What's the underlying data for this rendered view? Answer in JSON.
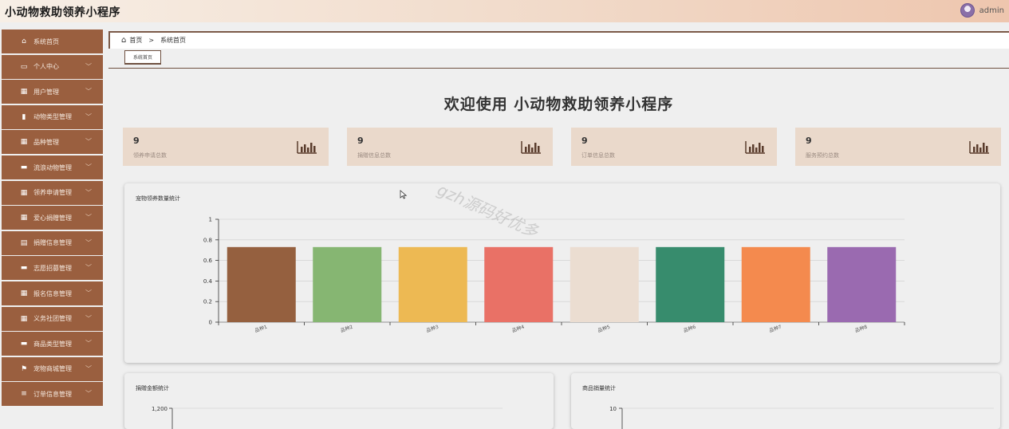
{
  "app": {
    "title": "小动物救助领养小程序",
    "user": "admin"
  },
  "sidebar": {
    "items": [
      {
        "icon": "home-icon",
        "glyph": "⌂",
        "label": "系统首页",
        "chevron": false
      },
      {
        "icon": "id-card-icon",
        "glyph": "▭",
        "label": "个人中心",
        "chevron": true
      },
      {
        "icon": "grid-icon",
        "glyph": "▦",
        "label": "用户管理",
        "chevron": true
      },
      {
        "icon": "bar-chart-icon",
        "glyph": "▮",
        "label": "动物类型管理",
        "chevron": true
      },
      {
        "icon": "grid-icon",
        "glyph": "▦",
        "label": "品种管理",
        "chevron": true
      },
      {
        "icon": "monitor-icon",
        "glyph": "▬",
        "label": "流浪动物管理",
        "chevron": true
      },
      {
        "icon": "grid-icon",
        "glyph": "▦",
        "label": "领养申请管理",
        "chevron": true
      },
      {
        "icon": "grid-icon",
        "glyph": "▦",
        "label": "爱心捐赠管理",
        "chevron": true
      },
      {
        "icon": "table-icon",
        "glyph": "▤",
        "label": "捐赠信息管理",
        "chevron": true
      },
      {
        "icon": "monitor-icon",
        "glyph": "▬",
        "label": "志愿招募管理",
        "chevron": true
      },
      {
        "icon": "grid-icon",
        "glyph": "▦",
        "label": "报名信息管理",
        "chevron": true
      },
      {
        "icon": "grid-icon",
        "glyph": "▦",
        "label": "义务社团管理",
        "chevron": true
      },
      {
        "icon": "chat-icon",
        "glyph": "▬",
        "label": "商品类型管理",
        "chevron": true
      },
      {
        "icon": "flag-icon",
        "glyph": "⚑",
        "label": "宠物商城管理",
        "chevron": true
      },
      {
        "icon": "list-icon",
        "glyph": "≡",
        "label": "订单信息管理",
        "chevron": true
      }
    ]
  },
  "breadcrumb": {
    "home": "首页",
    "sep": ">",
    "current": "系统首页"
  },
  "tabs": [
    "系统首页"
  ],
  "welcome": "欢迎使用 小动物救助领养小程序",
  "stats": [
    {
      "value": "9",
      "label": "领养申请总数"
    },
    {
      "value": "9",
      "label": "捐赠信息总数"
    },
    {
      "value": "9",
      "label": "订单信息总数"
    },
    {
      "value": "9",
      "label": "服务预约总数"
    }
  ],
  "watermark": "gzh源码好优多",
  "chart_data": [
    {
      "type": "bar",
      "title": "宠物领养数量统计",
      "categories": [
        "品种1",
        "品种2",
        "品种3",
        "品种4",
        "品种5",
        "品种6",
        "品种7",
        "品种8"
      ],
      "values": [
        0.73,
        0.73,
        0.73,
        0.73,
        0.73,
        0.73,
        0.73,
        0.73
      ],
      "colors": [
        "#95603f",
        "#86b672",
        "#edb953",
        "#e97166",
        "#ebddd1",
        "#378c6d",
        "#f48a4e",
        "#9a6ab0"
      ],
      "ylim": [
        0,
        1
      ],
      "yticks": [
        "0",
        "0.2",
        "0.4",
        "0.6",
        "0.8",
        "1"
      ],
      "grid": true
    },
    {
      "type": "bar",
      "title": "捐赠金额统计",
      "yticks_visible": [
        "1,200"
      ]
    },
    {
      "type": "bar",
      "title": "商品销量统计",
      "yticks_visible": [
        "10"
      ]
    }
  ]
}
